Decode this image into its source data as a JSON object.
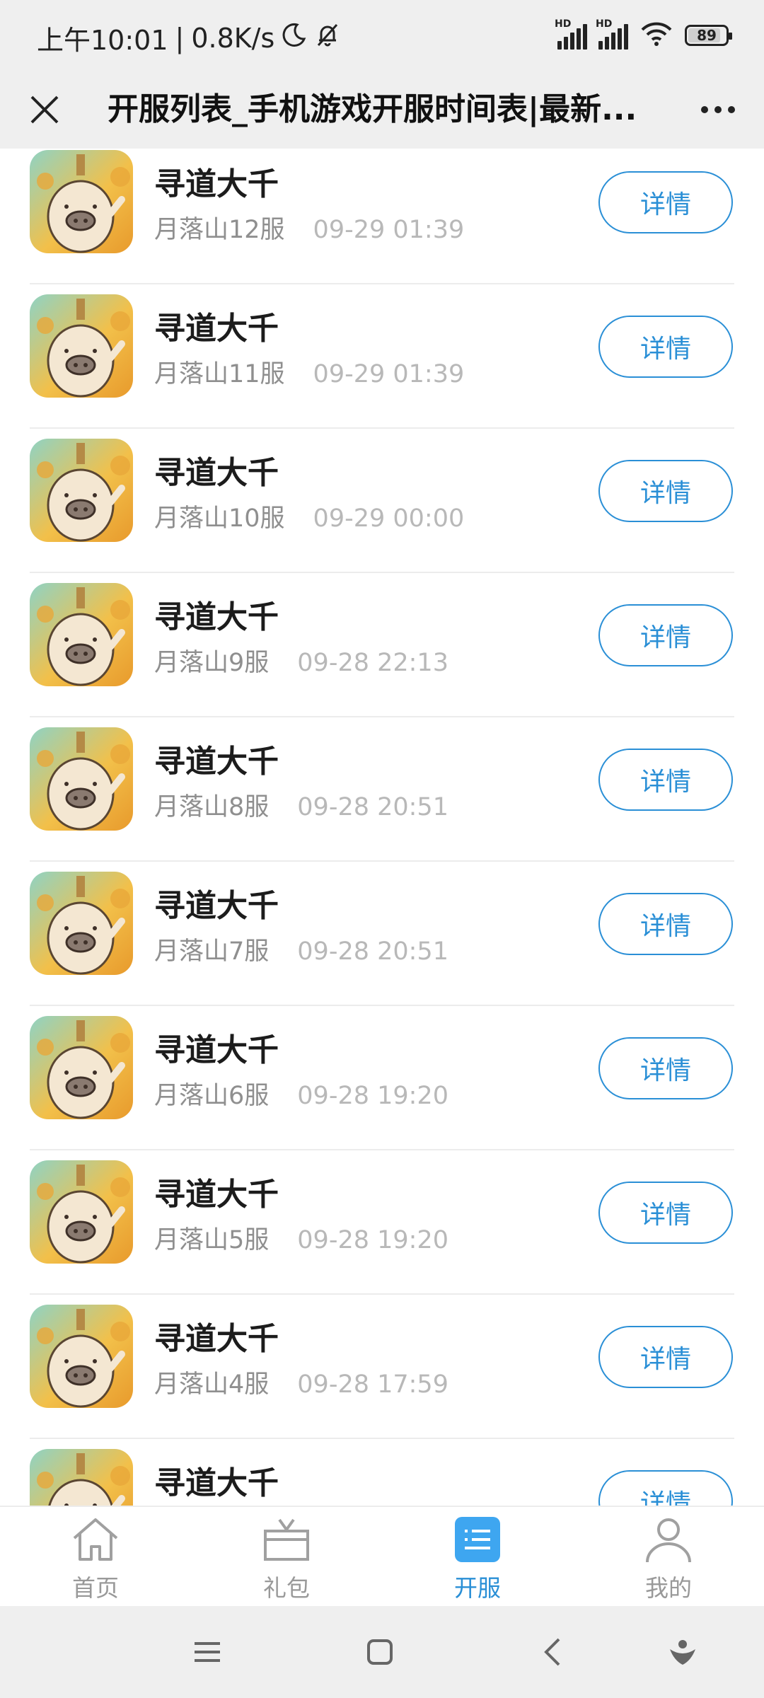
{
  "status_bar": {
    "time": "上午10:01",
    "separator": "|",
    "net_speed": "0.8K/s",
    "battery": "89",
    "hd_label": "HD"
  },
  "title_bar": {
    "title": "开服列表_手机游戏开服时间表|最新..."
  },
  "servers": [
    {
      "game": "寻道大千",
      "server": "月落山12服",
      "time": "09-29 01:39",
      "button": "详情"
    },
    {
      "game": "寻道大千",
      "server": "月落山11服",
      "time": "09-29 01:39",
      "button": "详情"
    },
    {
      "game": "寻道大千",
      "server": "月落山10服",
      "time": "09-29 00:00",
      "button": "详情"
    },
    {
      "game": "寻道大千",
      "server": "月落山9服",
      "time": "09-28 22:13",
      "button": "详情"
    },
    {
      "game": "寻道大千",
      "server": "月落山8服",
      "time": "09-28 20:51",
      "button": "详情"
    },
    {
      "game": "寻道大千",
      "server": "月落山7服",
      "time": "09-28 20:51",
      "button": "详情"
    },
    {
      "game": "寻道大千",
      "server": "月落山6服",
      "time": "09-28 19:20",
      "button": "详情"
    },
    {
      "game": "寻道大千",
      "server": "月落山5服",
      "time": "09-28 19:20",
      "button": "详情"
    },
    {
      "game": "寻道大千",
      "server": "月落山4服",
      "time": "09-28 17:59",
      "button": "详情"
    },
    {
      "game": "寻道大千",
      "server": "",
      "time": "",
      "button": "详情"
    }
  ],
  "bottom_nav": [
    {
      "label": "首页",
      "icon": "home-icon",
      "active": false
    },
    {
      "label": "礼包",
      "icon": "gift-icon",
      "active": false
    },
    {
      "label": "开服",
      "icon": "server-list-icon",
      "active": true
    },
    {
      "label": "我的",
      "icon": "user-icon",
      "active": false
    }
  ],
  "colors": {
    "accent": "#2a8fd6",
    "bar_background": "#efefef"
  }
}
